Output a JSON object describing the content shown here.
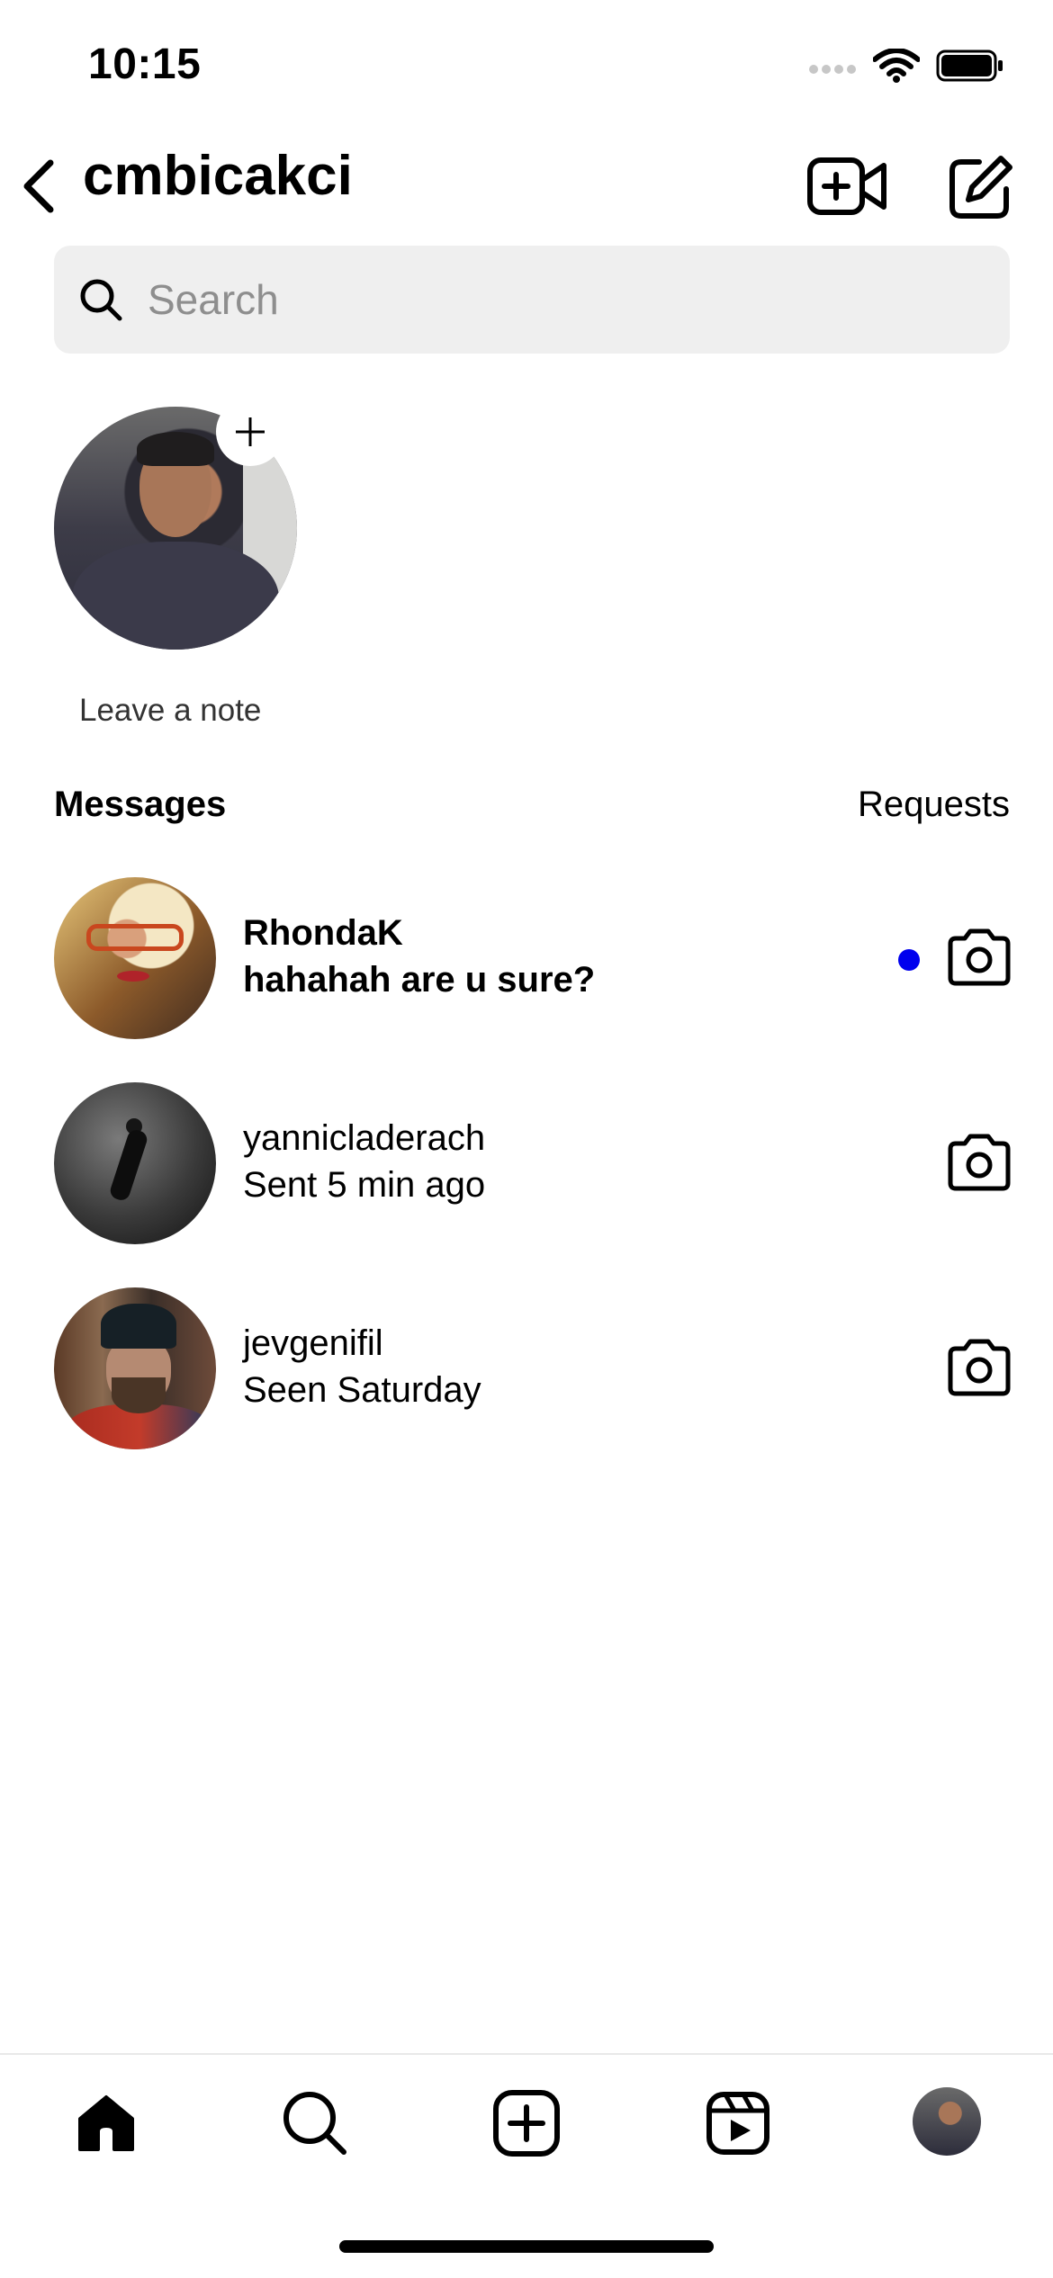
{
  "status_bar": {
    "time": "10:15"
  },
  "header": {
    "title": "cmbicakci"
  },
  "search": {
    "placeholder": "Search"
  },
  "note": {
    "label": "Leave a note"
  },
  "messages_section": {
    "heading": "Messages",
    "requests_label": "Requests"
  },
  "threads": [
    {
      "name": "RhondaK",
      "preview": "hahahah are u sure?",
      "unread": true
    },
    {
      "name": "yannicladerach",
      "preview": "Sent 5 min ago",
      "unread": false
    },
    {
      "name": "jevgenifil",
      "preview": "Seen Saturday",
      "unread": false
    }
  ],
  "colors": {
    "unread_dot": "#0000ee",
    "search_bg": "#efefef"
  },
  "icons": [
    "back-icon",
    "video-call-icon",
    "compose-icon",
    "search-icon",
    "camera-icon",
    "home-icon",
    "explore-icon",
    "create-icon",
    "reels-icon"
  ]
}
